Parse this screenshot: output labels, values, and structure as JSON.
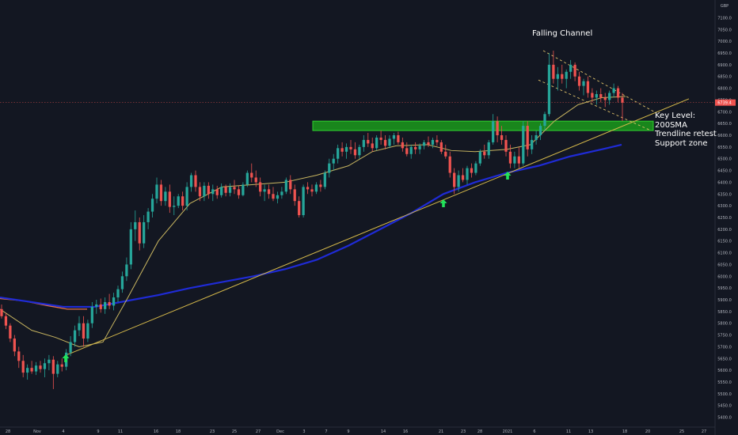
{
  "annotations": {
    "channel_label": "Falling Channel",
    "key_level": [
      "Key Level:",
      "200SMA",
      "Trendline retest",
      "Support zone"
    ]
  },
  "chart_data": {
    "type": "candlestick",
    "currency_label": "GBP",
    "last_price_label": "6739.4",
    "ylim": [
      5375,
      7125
    ],
    "y_ticks": [
      5400,
      5450,
      5500,
      5550,
      5600,
      5650,
      5700,
      5750,
      5800,
      5850,
      5900,
      5950,
      6000,
      6050,
      6100,
      6150,
      6200,
      6250,
      6300,
      6350,
      6400,
      6450,
      6500,
      6550,
      6600,
      6650,
      6700,
      6750,
      6800,
      6850,
      6900,
      6950,
      7000,
      7050,
      7100
    ],
    "x_ticks": [
      "28",
      "Nov",
      "4",
      "9",
      "11",
      "16",
      "18",
      "23",
      "25",
      "27",
      "Dec",
      "3",
      "7",
      "9",
      "14",
      "16",
      "21",
      "23",
      "28",
      "2021",
      "6",
      "11",
      "13",
      "18",
      "20",
      "25",
      "27"
    ],
    "colors": {
      "up": "#26a69a",
      "down": "#ef5350",
      "sma50": "#c8b560",
      "sma200": "#1f2bd6",
      "sma_other": "#e8744a",
      "zone": "#1b9a1b",
      "arrow": "#22e35a",
      "trendline": "#d4b84a",
      "channel": "#e0c26a"
    },
    "candles": [
      [
        5860,
        5880,
        5820,
        5830
      ],
      [
        5830,
        5845,
        5775,
        5790
      ],
      [
        5790,
        5800,
        5720,
        5735
      ],
      [
        5735,
        5750,
        5660,
        5680
      ],
      [
        5680,
        5700,
        5610,
        5640
      ],
      [
        5640,
        5665,
        5570,
        5590
      ],
      [
        5590,
        5625,
        5560,
        5610
      ],
      [
        5610,
        5640,
        5585,
        5595
      ],
      [
        5595,
        5635,
        5580,
        5620
      ],
      [
        5620,
        5640,
        5590,
        5605
      ],
      [
        5605,
        5650,
        5570,
        5630
      ],
      [
        5630,
        5665,
        5600,
        5645
      ],
      [
        5645,
        5660,
        5520,
        5585
      ],
      [
        5585,
        5640,
        5570,
        5625
      ],
      [
        5625,
        5650,
        5595,
        5615
      ],
      [
        5615,
        5690,
        5600,
        5675
      ],
      [
        5675,
        5745,
        5660,
        5720
      ],
      [
        5720,
        5790,
        5700,
        5770
      ],
      [
        5770,
        5830,
        5745,
        5800
      ],
      [
        5800,
        5830,
        5700,
        5735
      ],
      [
        5735,
        5815,
        5720,
        5800
      ],
      [
        5800,
        5890,
        5780,
        5870
      ],
      [
        5870,
        5900,
        5840,
        5880
      ],
      [
        5880,
        5905,
        5845,
        5860
      ],
      [
        5860,
        5910,
        5840,
        5890
      ],
      [
        5890,
        5925,
        5860,
        5875
      ],
      [
        5875,
        5930,
        5855,
        5910
      ],
      [
        5910,
        5960,
        5890,
        5945
      ],
      [
        5945,
        6020,
        5930,
        6000
      ],
      [
        6000,
        6080,
        5980,
        6050
      ],
      [
        6050,
        6230,
        6030,
        6200
      ],
      [
        6200,
        6280,
        6150,
        6230
      ],
      [
        6230,
        6250,
        6110,
        6140
      ],
      [
        6140,
        6260,
        6120,
        6230
      ],
      [
        6230,
        6290,
        6200,
        6275
      ],
      [
        6275,
        6350,
        6250,
        6330
      ],
      [
        6330,
        6420,
        6310,
        6390
      ],
      [
        6390,
        6410,
        6300,
        6320
      ],
      [
        6320,
        6380,
        6300,
        6360
      ],
      [
        6360,
        6390,
        6270,
        6295
      ],
      [
        6295,
        6340,
        6260,
        6300
      ],
      [
        6300,
        6350,
        6290,
        6340
      ],
      [
        6340,
        6360,
        6280,
        6300
      ],
      [
        6300,
        6400,
        6280,
        6380
      ],
      [
        6380,
        6440,
        6360,
        6430
      ],
      [
        6430,
        6450,
        6360,
        6380
      ],
      [
        6380,
        6400,
        6320,
        6340
      ],
      [
        6340,
        6400,
        6320,
        6385
      ],
      [
        6385,
        6400,
        6330,
        6350
      ],
      [
        6350,
        6390,
        6320,
        6370
      ],
      [
        6370,
        6385,
        6330,
        6345
      ],
      [
        6345,
        6395,
        6335,
        6380
      ],
      [
        6380,
        6390,
        6340,
        6355
      ],
      [
        6355,
        6395,
        6340,
        6380
      ],
      [
        6380,
        6410,
        6350,
        6370
      ],
      [
        6370,
        6385,
        6330,
        6345
      ],
      [
        6345,
        6400,
        6340,
        6390
      ],
      [
        6390,
        6450,
        6380,
        6440
      ],
      [
        6440,
        6480,
        6400,
        6420
      ],
      [
        6420,
        6450,
        6380,
        6400
      ],
      [
        6400,
        6420,
        6340,
        6360
      ],
      [
        6360,
        6390,
        6320,
        6370
      ],
      [
        6370,
        6390,
        6330,
        6350
      ],
      [
        6350,
        6380,
        6320,
        6330
      ],
      [
        6330,
        6360,
        6310,
        6345
      ],
      [
        6345,
        6380,
        6330,
        6360
      ],
      [
        6360,
        6420,
        6350,
        6410
      ],
      [
        6410,
        6430,
        6350,
        6370
      ],
      [
        6370,
        6390,
        6300,
        6320
      ],
      [
        6320,
        6340,
        6250,
        6260
      ],
      [
        6260,
        6390,
        6250,
        6380
      ],
      [
        6380,
        6400,
        6350,
        6370
      ],
      [
        6370,
        6390,
        6340,
        6360
      ],
      [
        6360,
        6400,
        6350,
        6390
      ],
      [
        6390,
        6410,
        6360,
        6380
      ],
      [
        6380,
        6450,
        6370,
        6440
      ],
      [
        6440,
        6500,
        6420,
        6480
      ],
      [
        6480,
        6520,
        6450,
        6500
      ],
      [
        6500,
        6560,
        6480,
        6545
      ],
      [
        6545,
        6570,
        6510,
        6530
      ],
      [
        6530,
        6565,
        6500,
        6550
      ],
      [
        6550,
        6580,
        6520,
        6540
      ],
      [
        6540,
        6570,
        6500,
        6515
      ],
      [
        6515,
        6560,
        6500,
        6550
      ],
      [
        6550,
        6600,
        6530,
        6580
      ],
      [
        6580,
        6610,
        6550,
        6565
      ],
      [
        6565,
        6590,
        6530,
        6545
      ],
      [
        6545,
        6600,
        6535,
        6590
      ],
      [
        6590,
        6620,
        6560,
        6580
      ],
      [
        6580,
        6600,
        6540,
        6555
      ],
      [
        6555,
        6600,
        6545,
        6585
      ],
      [
        6585,
        6610,
        6560,
        6600
      ],
      [
        6600,
        6615,
        6560,
        6570
      ],
      [
        6570,
        6590,
        6530,
        6545
      ],
      [
        6545,
        6570,
        6510,
        6520
      ],
      [
        6520,
        6560,
        6500,
        6550
      ],
      [
        6550,
        6570,
        6520,
        6540
      ],
      [
        6540,
        6565,
        6520,
        6555
      ],
      [
        6555,
        6580,
        6540,
        6570
      ],
      [
        6570,
        6595,
        6550,
        6560
      ],
      [
        6560,
        6590,
        6545,
        6580
      ],
      [
        6580,
        6600,
        6555,
        6570
      ],
      [
        6570,
        6580,
        6520,
        6530
      ],
      [
        6530,
        6560,
        6500,
        6510
      ],
      [
        6510,
        6530,
        6420,
        6440
      ],
      [
        6440,
        6460,
        6350,
        6380
      ],
      [
        6380,
        6450,
        6360,
        6430
      ],
      [
        6430,
        6460,
        6400,
        6410
      ],
      [
        6410,
        6470,
        6390,
        6460
      ],
      [
        6460,
        6480,
        6420,
        6440
      ],
      [
        6440,
        6490,
        6430,
        6480
      ],
      [
        6480,
        6540,
        6470,
        6530
      ],
      [
        6530,
        6560,
        6500,
        6515
      ],
      [
        6515,
        6580,
        6500,
        6570
      ],
      [
        6570,
        6690,
        6560,
        6660
      ],
      [
        6660,
        6680,
        6570,
        6600
      ],
      [
        6600,
        6640,
        6560,
        6580
      ],
      [
        6580,
        6600,
        6510,
        6530
      ],
      [
        6530,
        6560,
        6460,
        6480
      ],
      [
        6480,
        6530,
        6460,
        6510
      ],
      [
        6510,
        6550,
        6460,
        6480
      ],
      [
        6480,
        6660,
        6470,
        6640
      ],
      [
        6640,
        6660,
        6510,
        6540
      ],
      [
        6540,
        6600,
        6520,
        6580
      ],
      [
        6580,
        6620,
        6560,
        6600
      ],
      [
        6600,
        6650,
        6580,
        6640
      ],
      [
        6640,
        6700,
        6620,
        6690
      ],
      [
        6690,
        6950,
        6680,
        6900
      ],
      [
        6900,
        6960,
        6820,
        6840
      ],
      [
        6840,
        6890,
        6790,
        6860
      ],
      [
        6860,
        6900,
        6820,
        6840
      ],
      [
        6840,
        6880,
        6800,
        6870
      ],
      [
        6870,
        6920,
        6840,
        6900
      ],
      [
        6900,
        6910,
        6830,
        6850
      ],
      [
        6850,
        6870,
        6790,
        6810
      ],
      [
        6810,
        6840,
        6770,
        6830
      ],
      [
        6830,
        6850,
        6760,
        6780
      ],
      [
        6780,
        6800,
        6740,
        6760
      ],
      [
        6760,
        6790,
        6730,
        6775
      ],
      [
        6775,
        6800,
        6740,
        6760
      ],
      [
        6760,
        6780,
        6720,
        6750
      ],
      [
        6750,
        6790,
        6730,
        6780
      ],
      [
        6780,
        6820,
        6760,
        6800
      ],
      [
        6800,
        6810,
        6740,
        6760
      ],
      [
        6760,
        6780,
        6660,
        6739
      ]
    ],
    "sma50": [
      [
        0,
        5860
      ],
      [
        40,
        5770
      ],
      [
        70,
        5740
      ],
      [
        100,
        5700
      ],
      [
        130,
        5720
      ],
      [
        160,
        5900
      ],
      [
        200,
        6150
      ],
      [
        240,
        6310
      ],
      [
        280,
        6380
      ],
      [
        320,
        6390
      ],
      [
        360,
        6400
      ],
      [
        400,
        6430
      ],
      [
        440,
        6470
      ],
      [
        470,
        6530
      ],
      [
        500,
        6555
      ],
      [
        540,
        6560
      ],
      [
        570,
        6535
      ],
      [
        600,
        6530
      ],
      [
        640,
        6540
      ],
      [
        670,
        6560
      ],
      [
        700,
        6660
      ],
      [
        730,
        6730
      ],
      [
        760,
        6760
      ],
      [
        790,
        6765
      ]
    ],
    "sma200": [
      [
        0,
        5910
      ],
      [
        40,
        5890
      ],
      [
        80,
        5870
      ],
      [
        120,
        5870
      ],
      [
        160,
        5895
      ],
      [
        200,
        5920
      ],
      [
        240,
        5950
      ],
      [
        280,
        5975
      ],
      [
        320,
        6000
      ],
      [
        360,
        6030
      ],
      [
        400,
        6070
      ],
      [
        440,
        6130
      ],
      [
        480,
        6200
      ],
      [
        520,
        6270
      ],
      [
        560,
        6350
      ],
      [
        600,
        6400
      ],
      [
        640,
        6440
      ],
      [
        680,
        6470
      ],
      [
        720,
        6510
      ],
      [
        760,
        6540
      ],
      [
        785,
        6560
      ]
    ],
    "sma_other": [
      [
        0,
        5905
      ],
      [
        30,
        5895
      ],
      [
        60,
        5875
      ],
      [
        85,
        5860
      ],
      [
        110,
        5860
      ]
    ],
    "trendline": [
      [
        84,
        5665
      ],
      [
        870,
        6755
      ]
    ],
    "channel_upper": [
      [
        686,
        6960
      ],
      [
        826,
        6700
      ]
    ],
    "channel_lower": [
      [
        680,
        6835
      ],
      [
        822,
        6620
      ]
    ],
    "zone": [
      6620,
      6660
    ],
    "arrows_x": [
      83,
      560,
      641
    ]
  }
}
